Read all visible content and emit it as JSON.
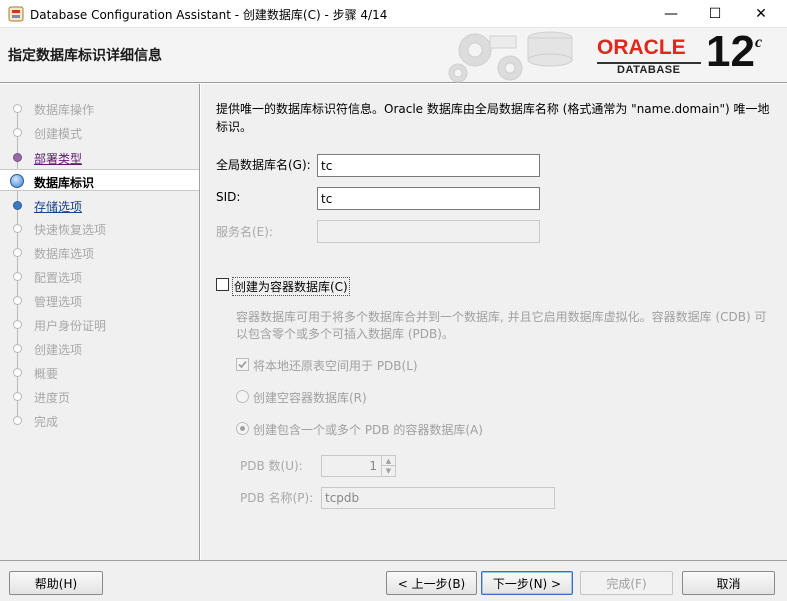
{
  "window": {
    "title": "Database Configuration Assistant - 创建数据库(C) - 步骤 4/14",
    "minimize": "—",
    "maximize": "☐",
    "close": "✕"
  },
  "header": {
    "title": "指定数据库标识详细信息",
    "logo_brand": "ORACLE",
    "logo_sub": "DATABASE",
    "logo_version": "12",
    "logo_version_suffix": "c",
    "brand_color": "#e2261c"
  },
  "nav": {
    "items": [
      {
        "label": "数据库操作",
        "state": "disabled"
      },
      {
        "label": "创建模式",
        "state": "disabled"
      },
      {
        "label": "部署类型",
        "state": "visited"
      },
      {
        "label": "数据库标识",
        "state": "active"
      },
      {
        "label": "存储选项",
        "state": "link"
      },
      {
        "label": "快速恢复选项",
        "state": "disabled"
      },
      {
        "label": "数据库选项",
        "state": "disabled"
      },
      {
        "label": "配置选项",
        "state": "disabled"
      },
      {
        "label": "管理选项",
        "state": "disabled"
      },
      {
        "label": "用户身份证明",
        "state": "disabled"
      },
      {
        "label": "创建选项",
        "state": "disabled"
      },
      {
        "label": "概要",
        "state": "disabled"
      },
      {
        "label": "进度页",
        "state": "disabled"
      },
      {
        "label": "完成",
        "state": "disabled"
      }
    ]
  },
  "content": {
    "description": "提供唯一的数据库标识符信息。Oracle 数据库由全局数据库名称 (格式通常为 \"name.domain\") 唯一地标识。",
    "global_db_name_label": "全局数据库名(G):",
    "global_db_name_value": "tc",
    "sid_label": "SID:",
    "sid_value": "tc",
    "service_name_label": "服务名(E):",
    "service_name_value": "",
    "container_checkbox_label": "创建为容器数据库(C)",
    "container_checked": false,
    "container_desc": "容器数据库可用于将多个数据库合并到一个数据库, 并且它启用数据库虚拟化。容器数据库 (CDB) 可以包含零个或多个可插入数据库 (PDB)。",
    "local_undo_label": "将本地还原表空间用于 PDB(L)",
    "local_undo_checked": true,
    "radio_empty_label": "创建空容器数据库(R)",
    "radio_with_pdb_label": "创建包含一个或多个 PDB 的容器数据库(A)",
    "pdb_count_label": "PDB 数(U):",
    "pdb_count_value": "1",
    "pdb_name_label": "PDB 名称(P):",
    "pdb_name_value": "tcpdb"
  },
  "footer": {
    "help": "帮助(H)",
    "back": "< 上一步(B)",
    "next": "下一步(N) >",
    "finish": "完成(F)",
    "cancel": "取消"
  }
}
